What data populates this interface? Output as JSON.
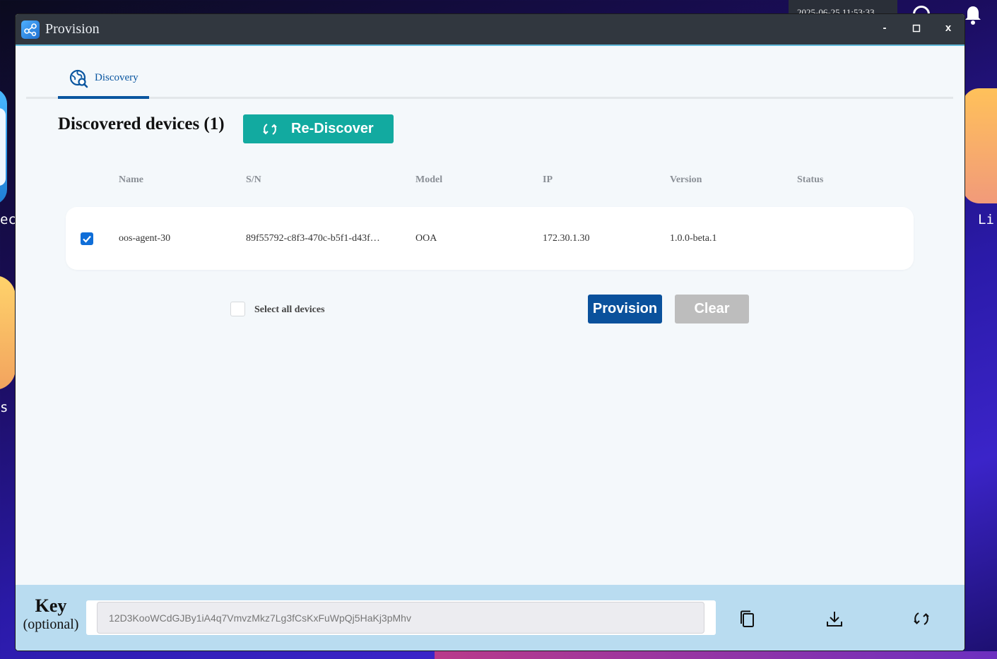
{
  "desktop": {
    "clock": "2025-06-25 11:53:33",
    "left_app_label": "ec",
    "left_app_label2": "s",
    "right_app_label": "Li"
  },
  "window": {
    "title": "Provision",
    "minimize_label": "-",
    "maximize_label": "◻",
    "close_label": "x"
  },
  "tabs": [
    {
      "label": "Discovery",
      "icon": "globe-search-icon",
      "active": true
    }
  ],
  "discovery": {
    "title": "Discovered devices (1)",
    "rediscover_label": "Re-Discover",
    "columns": [
      "Name",
      "S/N",
      "Model",
      "IP",
      "Version",
      "Status"
    ],
    "rows": [
      {
        "checked": true,
        "name": "oos-agent-30",
        "sn": "89f55792-c8f3-470c-b5f1-d43f…",
        "model": "OOA",
        "ip": "172.30.1.30",
        "version": "1.0.0-beta.1",
        "status": ""
      }
    ],
    "select_all_label": "Select all devices",
    "provision_label": "Provision",
    "clear_label": "Clear"
  },
  "footer": {
    "key_label": "Key",
    "key_optional": "(optional)",
    "key_value": "12D3KooWCdGJBy1iA4q7VmvzMkz7Lg3fCsKxFuWpQj5HaKj3pMhv"
  },
  "colors": {
    "accent_blue": "#0a519c",
    "teal": "#12aaa0",
    "footer_bg": "#b9dcf0",
    "titlebar": "#31373f"
  }
}
